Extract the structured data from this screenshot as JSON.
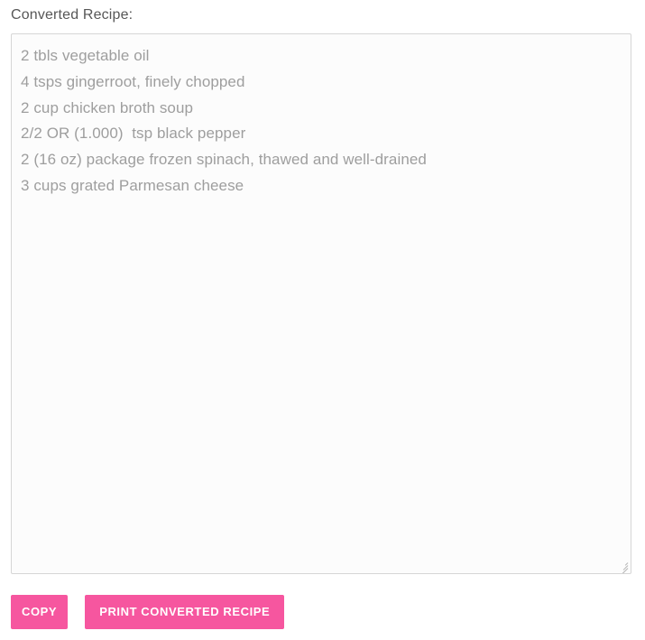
{
  "form": {
    "label": "Converted Recipe:"
  },
  "output": {
    "name": "converted-recipe-textarea",
    "lines": [
      "2 tbls vegetable oil",
      "4 tsps gingerroot, finely chopped",
      "2 cup chicken broth soup",
      "2/2 OR (1.000)  tsp black pepper",
      "2 (16 oz) package frozen spinach, thawed and well-drained",
      "3 cups grated Parmesan cheese"
    ]
  },
  "buttons": {
    "copy_label": "COPY",
    "print_label": "PRINT CONVERTED RECIPE"
  },
  "colors": {
    "accent_pink": "#f6569f",
    "label_text": "#575757",
    "output_text": "#9e9e9e",
    "field_border": "#d6d6d6",
    "field_background": "#fcfcfc",
    "page_background": "#ffffff"
  }
}
